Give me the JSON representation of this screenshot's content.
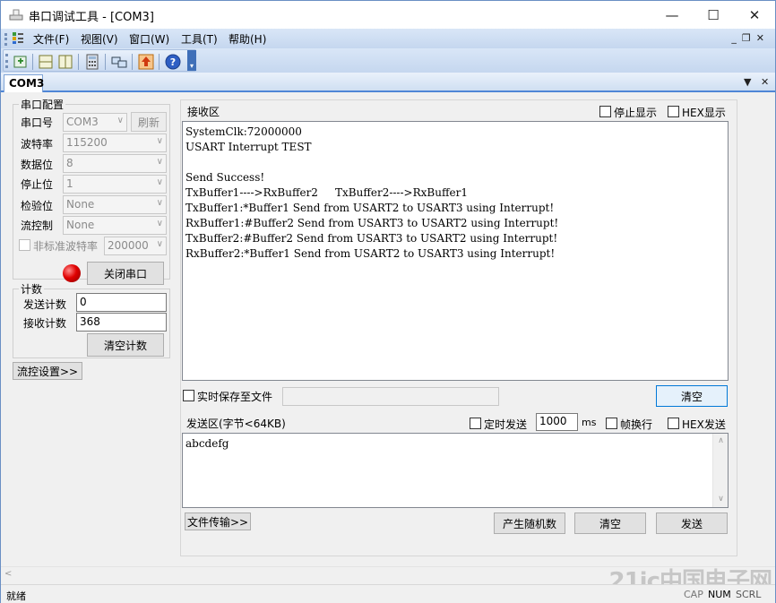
{
  "window": {
    "title": "串口调试工具 - [COM3]"
  },
  "menu": [
    "文件(F)",
    "视图(V)",
    "窗口(W)",
    "工具(T)",
    "帮助(H)"
  ],
  "tab": {
    "label": "COM3"
  },
  "serial_config": {
    "group_title": "串口配置",
    "port_label": "串口号",
    "port_value": "COM3",
    "refresh_label": "刷新",
    "baud_label": "波特率",
    "baud_value": "115200",
    "databits_label": "数据位",
    "databits_value": "8",
    "stopbits_label": "停止位",
    "stopbits_value": "1",
    "parity_label": "检验位",
    "parity_value": "None",
    "flow_label": "流控制",
    "flow_value": "None",
    "nonstd_label": "非标准波特率",
    "nonstd_value": "200000",
    "close_port_label": "关闭串口"
  },
  "counts": {
    "group_title": "计数",
    "sent_label": "发送计数",
    "sent_value": "0",
    "recv_label": "接收计数",
    "recv_value": "368",
    "clear_label": "清空计数"
  },
  "flow_settings_label": "流控设置>>",
  "receive": {
    "title": "接收区",
    "stop_display_label": "停止显示",
    "hex_display_label": "HEX显示",
    "lines": [
      "SystemClk:72000000",
      "USART Interrupt TEST",
      "",
      "Send Success!",
      "TxBuffer1---->RxBuffer2     TxBuffer2---->RxBuffer1",
      "TxBuffer1:*Buffer1 Send from USART2 to USART3 using Interrupt!",
      "RxBuffer1:#Buffer2 Send from USART3 to USART2 using Interrupt!",
      "TxBuffer2:#Buffer2 Send from USART3 to USART2 using Interrupt!",
      "RxBuffer2:*Buffer1 Send from USART2 to USART3 using Interrupt!"
    ],
    "save_to_file_label": "实时保存至文件",
    "clear_label": "清空"
  },
  "send": {
    "title": "发送区(字节<64KB)",
    "timed_send_label": "定时发送",
    "interval_value": "1000",
    "interval_unit": "ms",
    "newline_label": "帧换行",
    "hex_send_label": "HEX发送",
    "content": "abcdefg",
    "file_transfer_label": "文件传输>>",
    "random_label": "产生随机数",
    "clear_label": "清空",
    "send_label": "发送"
  },
  "status": {
    "left": "就绪",
    "cap": "CAP",
    "num": "NUM",
    "scrl": "SCRL"
  },
  "watermark": "21ic中国电子网"
}
